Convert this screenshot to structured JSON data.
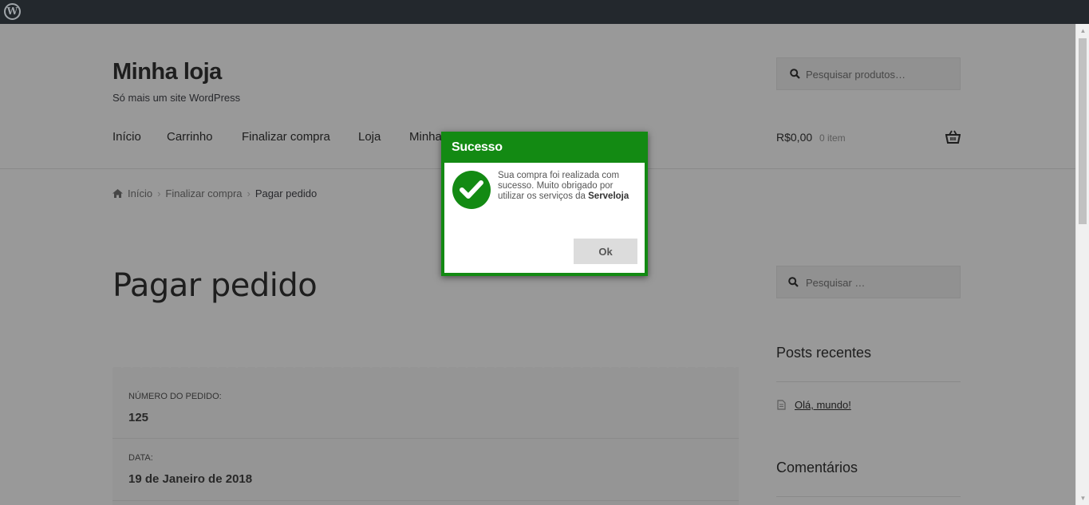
{
  "adminbar": {
    "logo_icon": "wordpress-logo-icon",
    "logo_letter": "W"
  },
  "site": {
    "title": "Minha loja",
    "description": "Só mais um site WordPress"
  },
  "header_search": {
    "placeholder": "Pesquisar produtos…",
    "icon": "search-icon"
  },
  "nav": {
    "items": [
      "Início",
      "Carrinho",
      "Finalizar compra",
      "Loja",
      "Minha conta"
    ]
  },
  "cart": {
    "amount": "R$0,00",
    "count": "0 item",
    "icon": "basket-icon"
  },
  "breadcrumb": {
    "items": [
      "Início",
      "Finalizar compra",
      "Pagar pedido"
    ],
    "separator": "›"
  },
  "page": {
    "title": "Pagar pedido"
  },
  "order": {
    "number_label": "NÚMERO DO PEDIDO:",
    "number_value": "125",
    "date_label": "DATA:",
    "date_value": "19 de Janeiro de 2018"
  },
  "sidebar": {
    "search_placeholder": "Pesquisar …",
    "recent_posts_title": "Posts recentes",
    "recent_posts": [
      "Olá, mundo!"
    ],
    "comments_title": "Comentários"
  },
  "dialog": {
    "title": "Sucesso",
    "message_start": "Sua compra foi realizada com sucesso. Muito obrigado por utilizar os serviços da ",
    "message_brand": "Serveloja",
    "ok_label": "Ok",
    "accent_color": "#138a13"
  }
}
